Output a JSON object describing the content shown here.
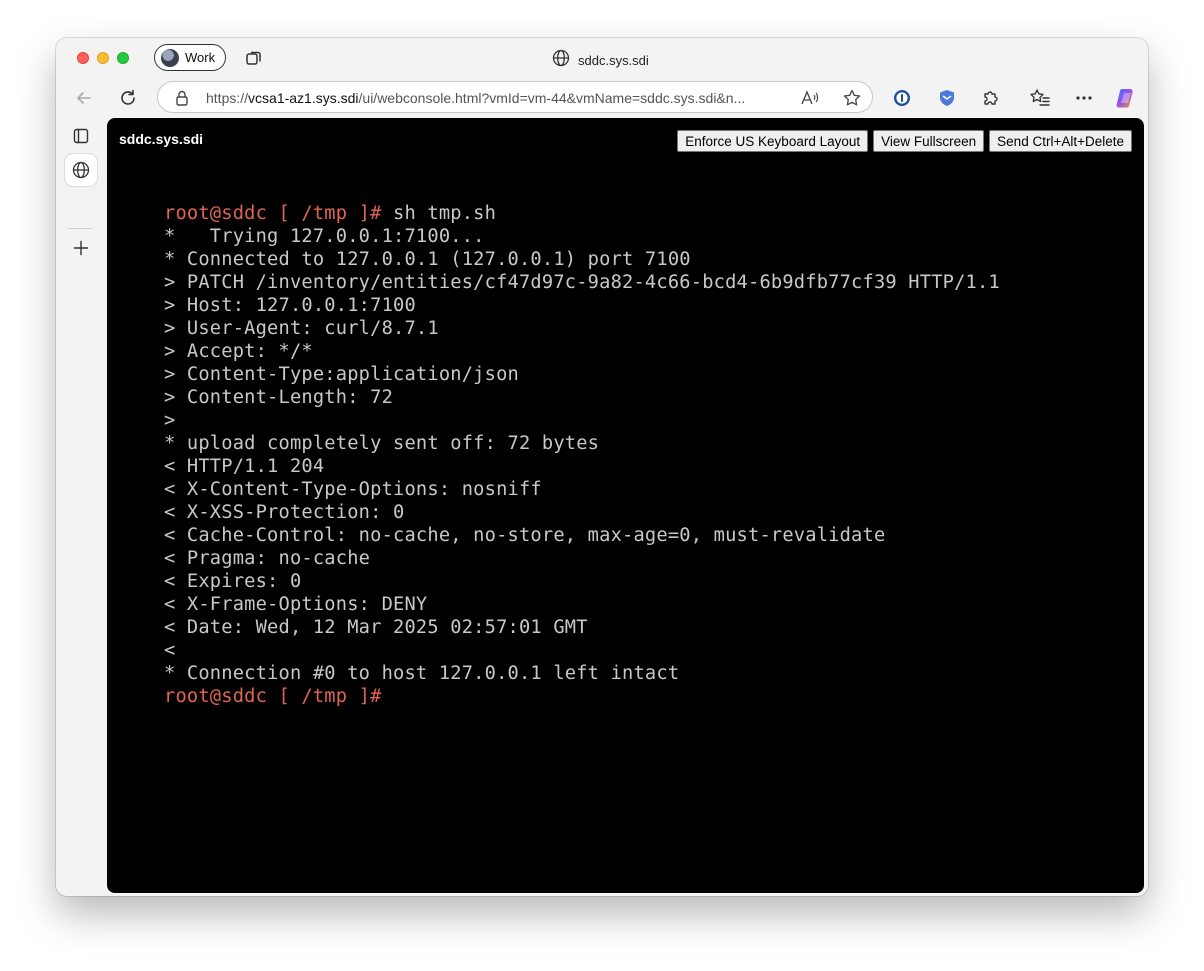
{
  "window": {
    "tab_title": "sddc.sys.sdi",
    "profile_label": "Work"
  },
  "toolbar": {
    "url_prefix": "https://",
    "url_host": "vcsa1-az1.sys.sdi",
    "url_rest": "/ui/webconsole.html?vmId=vm-44&vmName=sddc.sys.sdi&n...",
    "read_aloud_label": "A̓ͅ"
  },
  "console": {
    "vm_name": "sddc.sys.sdi",
    "buttons": {
      "enforce_keyboard": "Enforce US Keyboard Layout",
      "fullscreen": "View Fullscreen",
      "ctrl_alt_del": "Send Ctrl+Alt+Delete"
    }
  },
  "terminal": {
    "lines": [
      {
        "prompt": "root@sddc [ /tmp ]#",
        "text": " sh tmp.sh"
      },
      {
        "text": "*   Trying 127.0.0.1:7100..."
      },
      {
        "text": "* Connected to 127.0.0.1 (127.0.0.1) port 7100"
      },
      {
        "text": "> PATCH /inventory/entities/cf47d97c-9a82-4c66-bcd4-6b9dfb77cf39 HTTP/1.1"
      },
      {
        "text": "> Host: 127.0.0.1:7100"
      },
      {
        "text": "> User-Agent: curl/8.7.1"
      },
      {
        "text": "> Accept: */*"
      },
      {
        "text": "> Content-Type:application/json"
      },
      {
        "text": "> Content-Length: 72"
      },
      {
        "text": ">"
      },
      {
        "text": "* upload completely sent off: 72 bytes"
      },
      {
        "text": "< HTTP/1.1 204"
      },
      {
        "text": "< X-Content-Type-Options: nosniff"
      },
      {
        "text": "< X-XSS-Protection: 0"
      },
      {
        "text": "< Cache-Control: no-cache, no-store, max-age=0, must-revalidate"
      },
      {
        "text": "< Pragma: no-cache"
      },
      {
        "text": "< Expires: 0"
      },
      {
        "text": "< X-Frame-Options: DENY"
      },
      {
        "text": "< Date: Wed, 12 Mar 2025 02:57:01 GMT"
      },
      {
        "text": "<"
      },
      {
        "text": "* Connection #0 to host 127.0.0.1 left intact"
      },
      {
        "prompt": "root@sddc [ /tmp ]#",
        "text": ""
      }
    ]
  },
  "colors": {
    "prompt": "#e06455",
    "terminal_text": "#c8c8c8",
    "console_bg": "#000000"
  },
  "icons": {
    "traffic_lights": [
      "close-icon",
      "minimize-icon",
      "maximize-icon"
    ],
    "toolbar": [
      "back-arrow-icon",
      "reload-icon",
      "lock-icon",
      "read-aloud-icon",
      "favorite-star-icon",
      "password-manager-icon",
      "shield-extension-icon",
      "extensions-puzzle-icon",
      "favorites-icon",
      "more-icon",
      "copilot-icon"
    ],
    "sidebar": [
      "sidebar-tabs-icon",
      "globe-icon",
      "add-icon"
    ]
  }
}
